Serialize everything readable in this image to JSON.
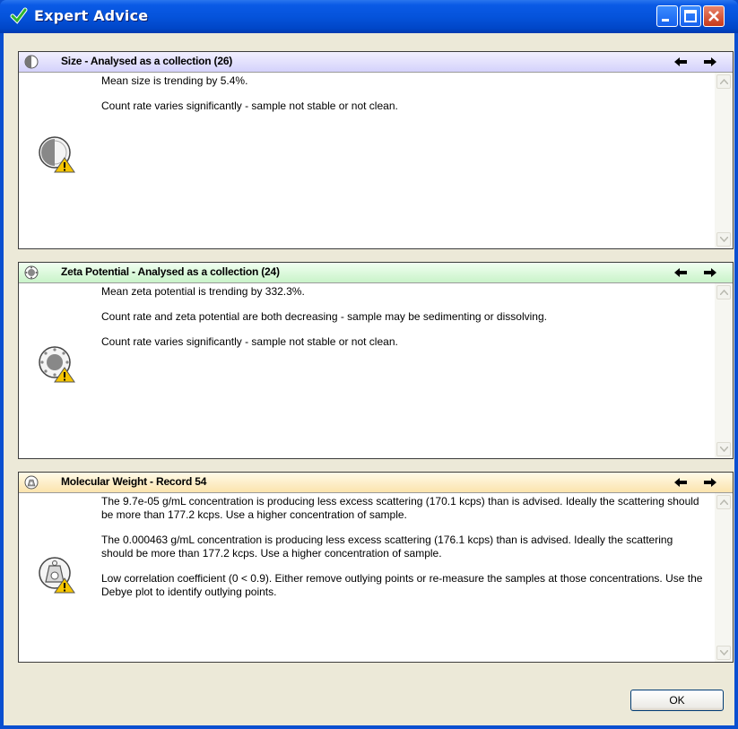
{
  "window": {
    "title": "Expert Advice",
    "icon": "green-check-icon",
    "controls": [
      "minimize",
      "maximize",
      "close"
    ]
  },
  "panels": [
    {
      "title": "Size - Analysed as a collection (26)",
      "icon": "size-icon",
      "header_color": "#d4d2fb",
      "messages": [
        "Mean size is trending by 5.4%.",
        "Count rate varies significantly - sample not stable or not clean."
      ]
    },
    {
      "title": "Zeta Potential - Analysed as a collection (24)",
      "icon": "zeta-icon",
      "header_color": "#c9f3c9",
      "messages": [
        "Mean zeta potential is trending by 332.3%.",
        "Count rate and zeta potential are both decreasing - sample may be sedimenting or dissolving.",
        "Count rate varies significantly - sample not stable or not clean."
      ]
    },
    {
      "title": "Molecular Weight - Record 54",
      "icon": "molecular-weight-icon",
      "header_color": "#fbe3ad",
      "messages": [
        "The 9.7e-05 g/mL concentration is producing less excess scattering (170.1 kcps) than is advised. Ideally the scattering should be more than 177.2 kcps.  Use a higher concentration of sample.",
        "The 0.000463 g/mL concentration is producing less excess scattering (176.1 kcps) than is advised. Ideally the scattering should be more than 177.2 kcps.  Use a higher concentration of sample.",
        "Low correlation coefficient (0 < 0.9).  Either remove outlying points or re-measure the samples at those concentrations.  Use the Debye plot to identify outlying points."
      ]
    }
  ],
  "footer": {
    "ok_label": "OK"
  }
}
